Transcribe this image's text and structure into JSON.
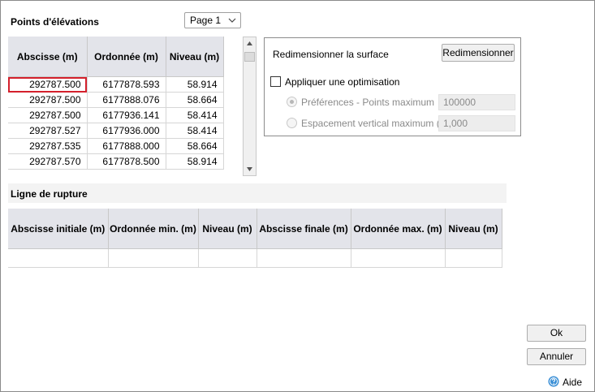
{
  "elevations": {
    "title": "Points d'élévations",
    "page_select": "Page 1",
    "columns": [
      "Abscisse (m)",
      "Ordonnée (m)",
      "Niveau (m)"
    ],
    "rows": [
      [
        "292787.500",
        "6177878.593",
        "58.914"
      ],
      [
        "292787.500",
        "6177888.076",
        "58.664"
      ],
      [
        "292787.500",
        "6177936.141",
        "58.414"
      ],
      [
        "292787.527",
        "6177936.000",
        "58.414"
      ],
      [
        "292787.535",
        "6177888.000",
        "58.664"
      ],
      [
        "292787.570",
        "6177878.500",
        "58.914"
      ]
    ]
  },
  "resize_panel": {
    "label": "Redimensionner la surface",
    "button": "Redimensionner",
    "optimize_checkbox": "Appliquer une optimisation",
    "option1_label": "Préférences - Points maximum",
    "option1_value": "100000",
    "option2_label": "Espacement vertical maximum (m)",
    "option2_value": "1,000"
  },
  "breakline": {
    "title": "Ligne de rupture",
    "columns": [
      "Abscisse initiale (m)",
      "Ordonnée min. (m)",
      "Niveau (m)",
      "Abscisse finale (m)",
      "Ordonnée max. (m)",
      "Niveau (m)"
    ]
  },
  "footer": {
    "ok": "Ok",
    "cancel": "Annuler",
    "help": "Aide"
  },
  "colors": {
    "header_bg": "#e3e4ea",
    "selected_cell_border": "#d4202c",
    "help_icon": "#3a8fd6"
  }
}
